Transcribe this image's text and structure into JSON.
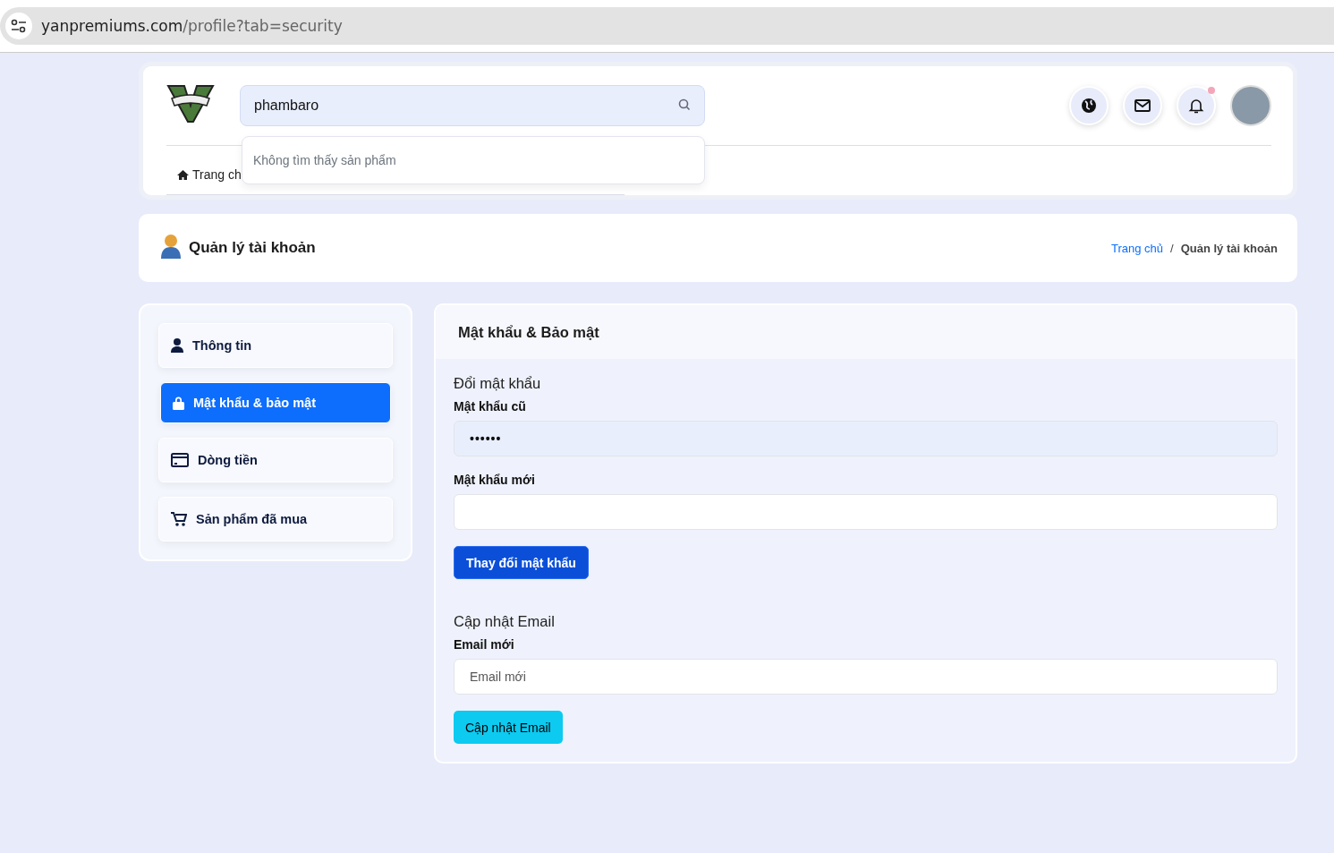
{
  "address_bar": {
    "domain": "yanpremiums.com",
    "path": "/profile?tab=security"
  },
  "header": {
    "search": {
      "value": "phambaro"
    },
    "search_dropdown": {
      "message": "Không tìm thấy sản phẩm"
    },
    "nav": [
      {
        "label": "Trang ch"
      }
    ],
    "notification_dot": true
  },
  "page_title": {
    "title": "Quản lý tài khoản",
    "breadcrumb_separator": "/",
    "breadcrumb": [
      {
        "label": "Trang chủ",
        "kind": "link"
      },
      {
        "label": "Quản lý tài khoản",
        "kind": "current"
      }
    ]
  },
  "sidebar": {
    "items": [
      {
        "label": "Thông tin",
        "kind": "user",
        "selected": false
      },
      {
        "label": "Mật khẩu & bảo mật",
        "kind": "lock",
        "selected": true
      },
      {
        "label": "Dòng tiền",
        "kind": "card",
        "selected": false
      },
      {
        "label": "Sản phẩm đã mua",
        "kind": "cart",
        "selected": false
      }
    ]
  },
  "panel": {
    "title": "Mật khẩu & Bảo mật",
    "sections": [
      {
        "heading": "Đổi mật khẩu",
        "fields": [
          {
            "label": "Mật khẩu cũ",
            "value": "••••••",
            "filled": true
          },
          {
            "label": "Mật khẩu mới",
            "filled": false
          }
        ],
        "button": {
          "label": "Thay đổi mật khẩu",
          "kind": "primary"
        }
      },
      {
        "heading": "Cập nhật Email",
        "fields": [
          {
            "label": "Email mới",
            "placeholder": "Email mới",
            "filled": false
          }
        ],
        "button": {
          "label": "Cập nhật Email",
          "kind": "info"
        }
      }
    ]
  }
}
